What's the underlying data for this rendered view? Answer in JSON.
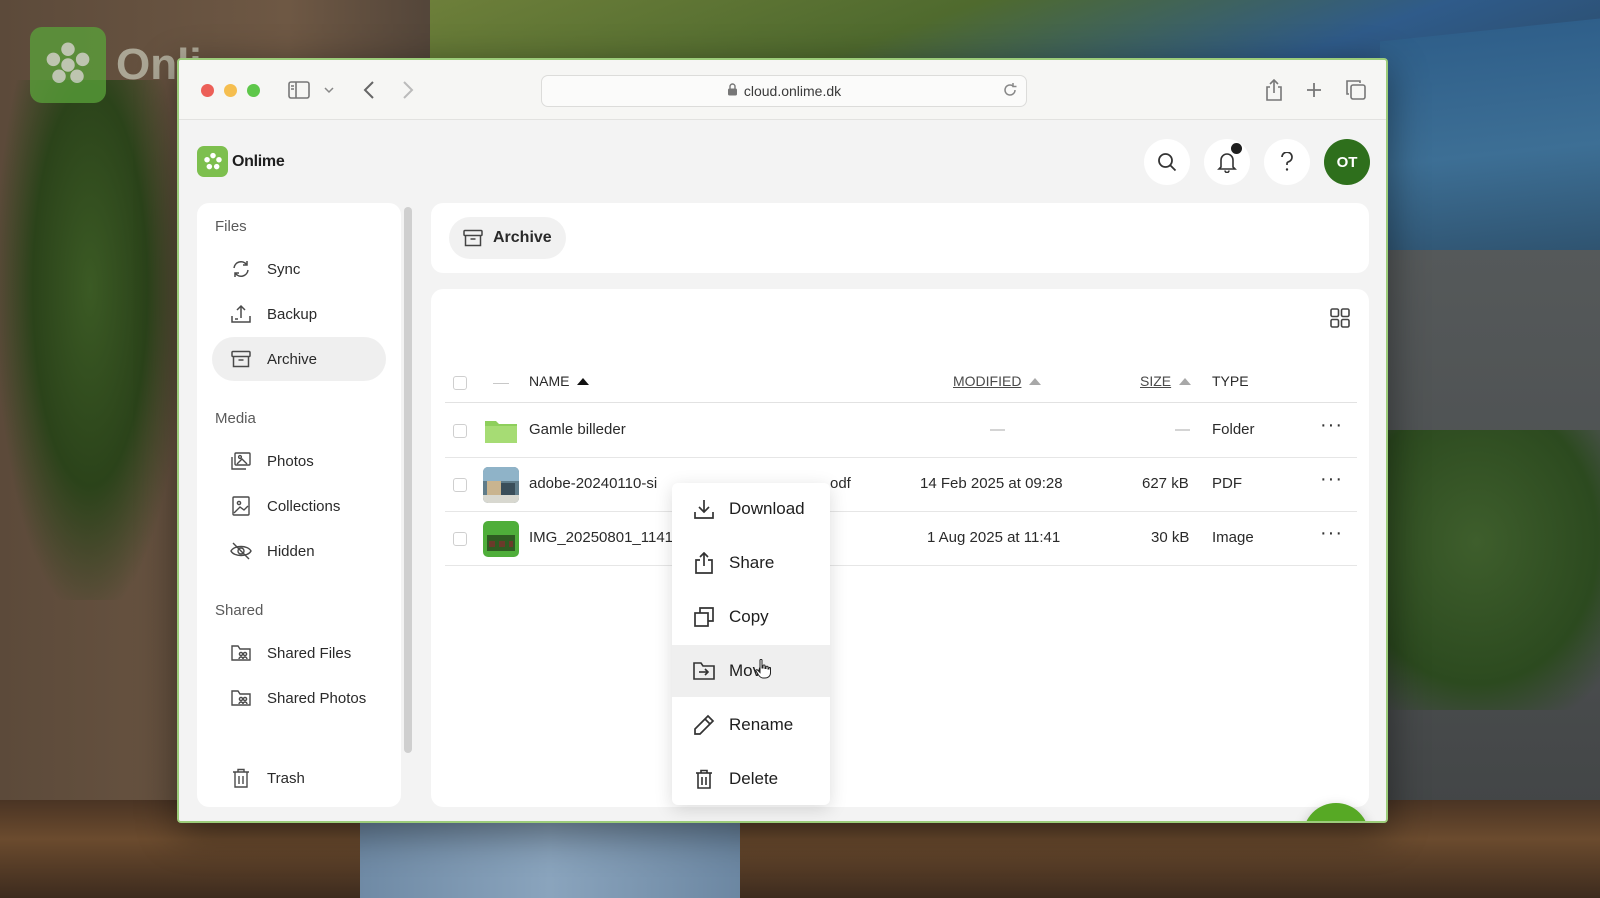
{
  "background": {
    "brand_text": "Onli"
  },
  "browser": {
    "url": "cloud.onlime.dk"
  },
  "app": {
    "brand": "Onlime",
    "avatar_initials": "OT",
    "accent_color": "#57a925"
  },
  "sidebar": {
    "sections": [
      {
        "title": "Files",
        "items": [
          {
            "label": "Sync",
            "icon": "sync-icon"
          },
          {
            "label": "Backup",
            "icon": "upload-icon"
          },
          {
            "label": "Archive",
            "icon": "archive-icon",
            "active": true
          }
        ]
      },
      {
        "title": "Media",
        "items": [
          {
            "label": "Photos",
            "icon": "photos-icon"
          },
          {
            "label": "Collections",
            "icon": "collections-icon"
          },
          {
            "label": "Hidden",
            "icon": "eye-off-icon"
          }
        ]
      },
      {
        "title": "Shared",
        "items": [
          {
            "label": "Shared Files",
            "icon": "shared-folder-icon"
          },
          {
            "label": "Shared Photos",
            "icon": "shared-photos-icon"
          }
        ]
      }
    ],
    "trash_label": "Trash"
  },
  "breadcrumb": {
    "label": "Archive"
  },
  "table": {
    "columns": {
      "name": "NAME",
      "modified": "MODIFIED",
      "size": "SIZE",
      "type": "TYPE"
    },
    "rows": [
      {
        "name": "Gamle billeder",
        "modified": "—",
        "size": "—",
        "type": "Folder"
      },
      {
        "name": "adobe-20240110-si",
        "name_tail": "odf",
        "modified": "14 Feb 2025 at 09:28",
        "size": "627 kB",
        "type": "PDF"
      },
      {
        "name": "IMG_20250801_1141",
        "modified": "1 Aug 2025 at 11:41",
        "size": "30 kB",
        "type": "Image"
      }
    ],
    "row_menu_glyph": "···"
  },
  "context_menu": {
    "items": [
      {
        "label": "Download",
        "icon": "download-icon"
      },
      {
        "label": "Share",
        "icon": "share-icon"
      },
      {
        "label": "Copy",
        "icon": "copy-icon"
      },
      {
        "label": "Move",
        "icon": "move-icon",
        "hovered": true
      },
      {
        "label": "Rename",
        "icon": "pencil-icon"
      },
      {
        "label": "Delete",
        "icon": "trash-icon"
      }
    ]
  }
}
